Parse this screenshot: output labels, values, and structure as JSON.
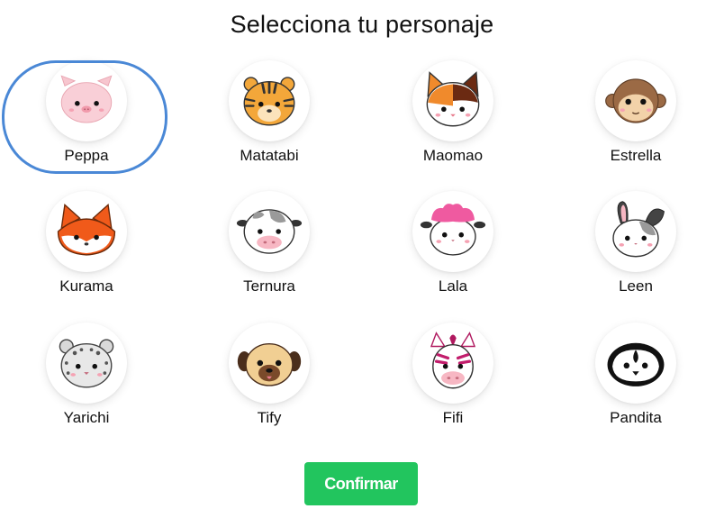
{
  "header": {
    "title": "Selecciona tu personaje"
  },
  "selected": "Peppa",
  "characters": [
    {
      "label": "Peppa",
      "icon": "pig-icon"
    },
    {
      "label": "Matatabi",
      "icon": "tiger-icon"
    },
    {
      "label": "Maomao",
      "icon": "calico-cat-icon"
    },
    {
      "label": "Estrella",
      "icon": "monkey-icon"
    },
    {
      "label": "Kurama",
      "icon": "fox-icon"
    },
    {
      "label": "Ternura",
      "icon": "cow-icon"
    },
    {
      "label": "Lala",
      "icon": "sheep-icon"
    },
    {
      "label": "Leen",
      "icon": "rabbit-icon"
    },
    {
      "label": "Yarichi",
      "icon": "snow-leopard-icon"
    },
    {
      "label": "Tify",
      "icon": "pug-icon"
    },
    {
      "label": "Fifi",
      "icon": "zebra-icon"
    },
    {
      "label": "Pandita",
      "icon": "penguin-icon"
    }
  ],
  "actions": {
    "confirm_label": "Confirmar"
  },
  "colors": {
    "confirm": "#22c55e",
    "selection_ring": "#4a88d6"
  }
}
